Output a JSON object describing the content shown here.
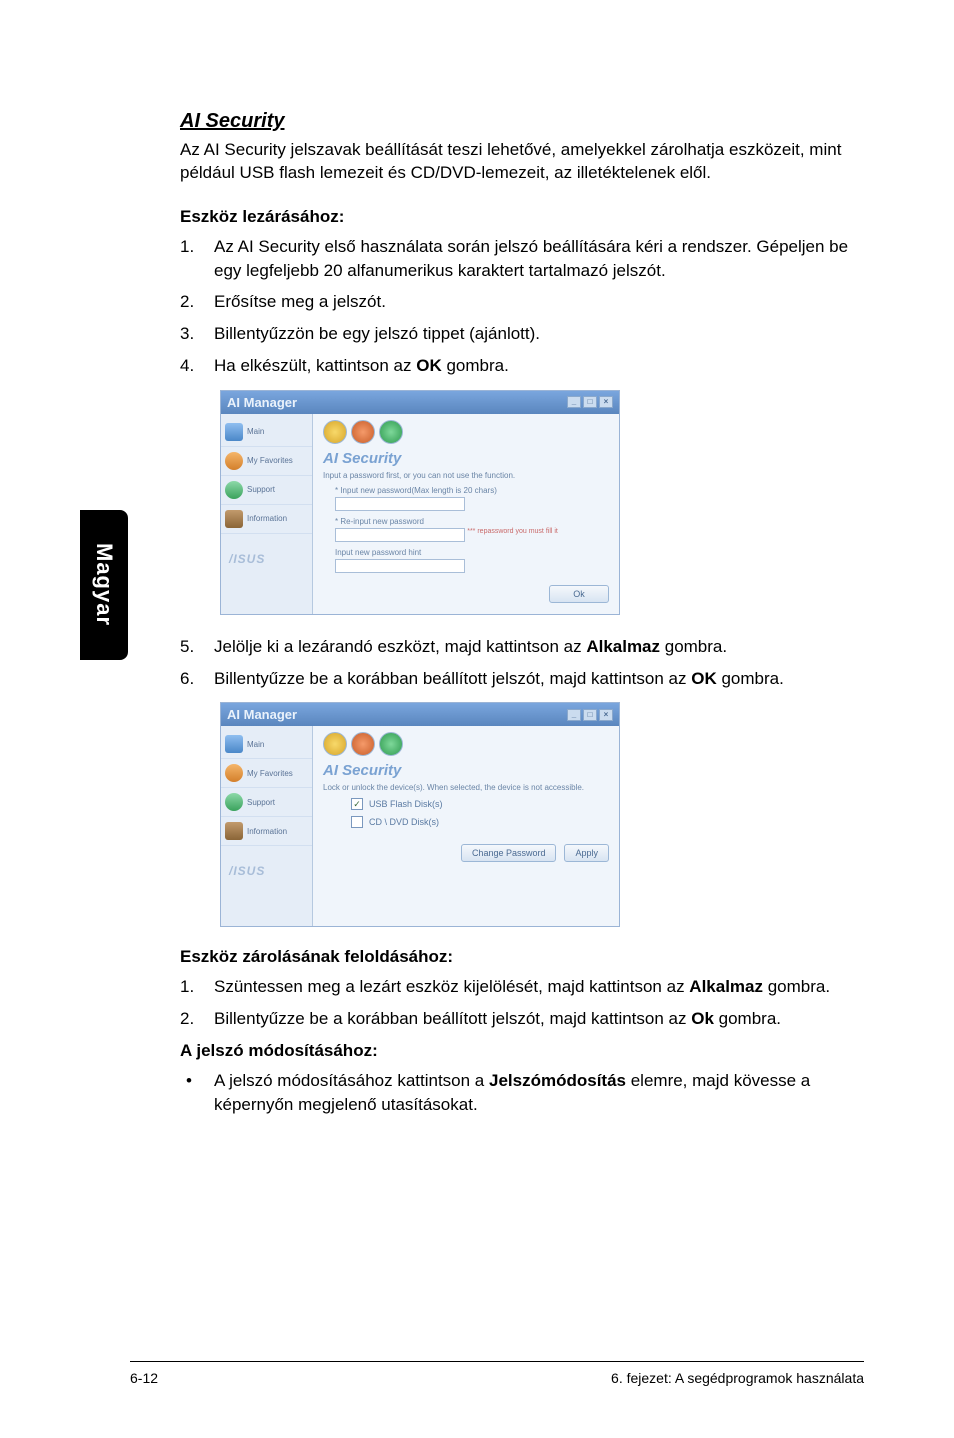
{
  "sideTab": "Magyar",
  "title": "AI Security",
  "intro": "Az AI Security jelszavak beállítását teszi lehetővé, amelyekkel zárolhatja eszközeit, mint például USB flash lemezeit és CD/DVD-lemezeit, az illetéktelenek elől.",
  "lockHead": "Eszköz lezárásához:",
  "steps1": {
    "s1": {
      "n": "1.",
      "t": "Az AI Security első használata során jelszó beállítására kéri a rendszer. Gépeljen be egy legfeljebb 20 alfanumerikus karaktert tartalmazó jelszót."
    },
    "s2": {
      "n": "2.",
      "t": "Erősítse meg a jelszót."
    },
    "s3": {
      "n": "3.",
      "t": "Billentyűzzön be egy jelszó tippet (ajánlott)."
    },
    "s4": {
      "n": "4.",
      "tPre": "Ha elkészült, kattintson az ",
      "b": "OK",
      "tPost": " gombra."
    },
    "s5": {
      "n": "5.",
      "tPre": "Jelölje ki a lezárandó eszközt, majd kattintson az ",
      "b": "Alkalmaz",
      "tPost": " gombra."
    },
    "s6": {
      "n": "6.",
      "tPre": "Billentyűzze be a korábban beállított jelszót, majd kattintson az ",
      "b": "OK",
      "tPost": " gombra."
    }
  },
  "unlockHead": "Eszköz zárolásának feloldásához:",
  "steps2": {
    "s1": {
      "n": "1.",
      "tPre": "Szüntessen meg a lezárt eszköz kijelölését, majd kattintson az ",
      "b": "Alkalmaz",
      "tPost": " gombra."
    },
    "s2": {
      "n": "2.",
      "tPre": "Billentyűzze be a korábban beállított jelszót, majd kattintson az ",
      "b": "Ok",
      "tPost": " gombra."
    }
  },
  "pwHead": "A jelszó módosításához:",
  "pwBullet": {
    "tPre": "A jelszó módosításához kattintson a ",
    "b": "Jelszómódosítás",
    "tPost": " elemre, majd kövesse a képernyőn megjelenő utasításokat."
  },
  "ss": {
    "title": "AI Manager",
    "side": {
      "main": "Main",
      "fav": "My Favorites",
      "support": "Support",
      "info": "Information"
    },
    "logo": "/ISUS",
    "heading": "AI Security",
    "desc1": "Input a password first, or you can not use the function.",
    "fld1": "* Input new password(Max length is 20 chars)",
    "fld2": "* Re-input new password",
    "hint": "*** repassword you must fill it",
    "fld3": "Input new password hint",
    "ok": "Ok",
    "desc2": "Lock or unlock the device(s). When selected, the device is not accessible.",
    "chk1": "USB Flash Disk(s)",
    "chk2": "CD \\ DVD Disk(s)",
    "btnChange": "Change Password",
    "btnApply": "Apply"
  },
  "footer": {
    "left": "6-12",
    "right": "6. fejezet: A segédprogramok használata"
  }
}
